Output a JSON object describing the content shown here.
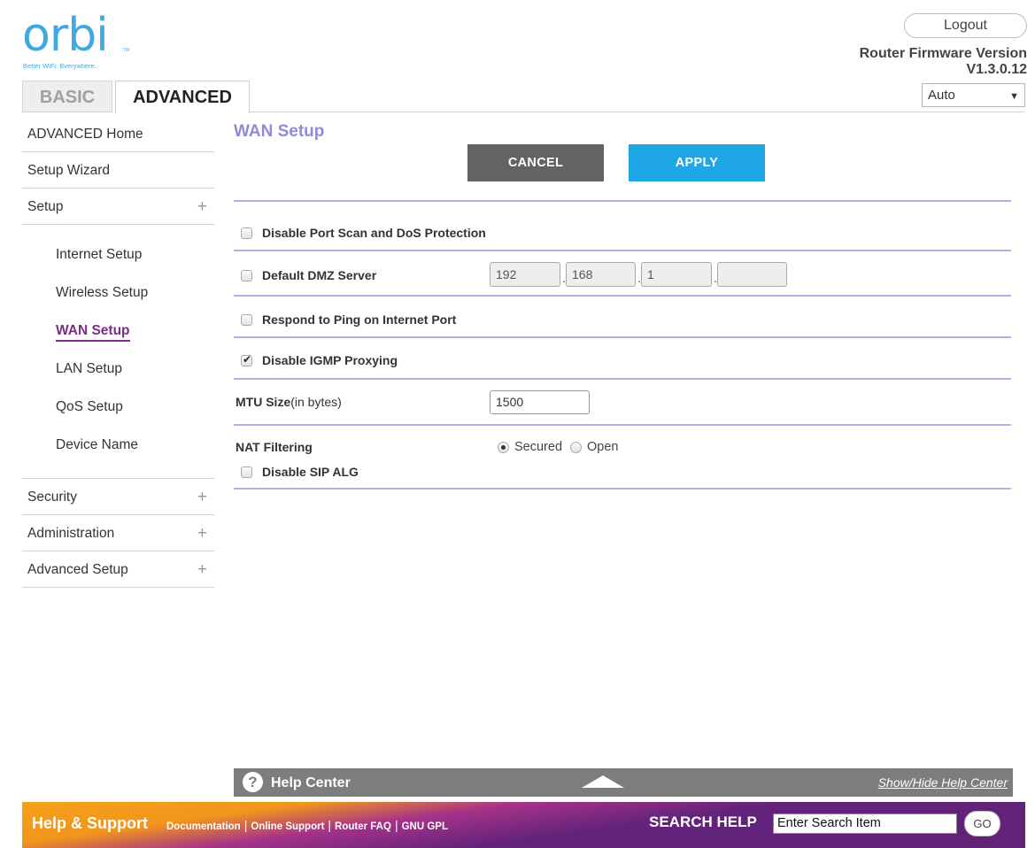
{
  "header": {
    "logo_text": "orbi",
    "logo_tm": "TM",
    "tagline": "Better WiFi. Everywhere.",
    "logout_label": "Logout",
    "firmware_label": "Router Firmware Version",
    "firmware_version": "V1.3.0.12",
    "language_value": "Auto"
  },
  "tabs": [
    {
      "label": "BASIC",
      "active": false
    },
    {
      "label": "ADVANCED",
      "active": true
    }
  ],
  "sidebar": {
    "items": [
      {
        "label": "ADVANCED Home"
      },
      {
        "label": "Setup Wizard"
      },
      {
        "label": "Setup",
        "expand": "+"
      }
    ],
    "setup_subitems": [
      {
        "label": "Internet Setup"
      },
      {
        "label": "Wireless Setup"
      },
      {
        "label": "WAN Setup",
        "active": true
      },
      {
        "label": "LAN Setup"
      },
      {
        "label": "QoS Setup"
      },
      {
        "label": "Device Name"
      }
    ],
    "bottom_items": [
      {
        "label": "Security",
        "expand": "+"
      },
      {
        "label": "Administration",
        "expand": "+"
      },
      {
        "label": "Advanced Setup",
        "expand": "+"
      }
    ]
  },
  "main": {
    "title": "WAN Setup",
    "cancel_label": "CANCEL",
    "apply_label": "APPLY",
    "disable_port_scan": {
      "label": "Disable Port Scan and DoS Protection",
      "checked": false
    },
    "default_dmz": {
      "label": "Default DMZ Server",
      "checked": false,
      "ip": [
        "192",
        "168",
        "1",
        ""
      ]
    },
    "respond_ping": {
      "label": "Respond to Ping on Internet Port",
      "checked": false
    },
    "disable_igmp": {
      "label": "Disable IGMP Proxying",
      "checked": true
    },
    "mtu": {
      "label": "MTU Size",
      "unit": "(in bytes)",
      "value": "1500"
    },
    "nat": {
      "label": "NAT Filtering",
      "options": [
        "Secured",
        "Open"
      ],
      "selected": "Secured"
    },
    "disable_sip": {
      "label": "Disable SIP ALG",
      "checked": false
    }
  },
  "help": {
    "title": "Help Center",
    "toggle": "Show/Hide Help Center"
  },
  "footer": {
    "title": "Help & Support",
    "links": [
      "Documentation",
      "Online Support",
      "Router FAQ",
      "GNU GPL"
    ],
    "search_label": "SEARCH HELP",
    "search_value": "Enter Search Item",
    "go_label": "GO"
  },
  "colors": {
    "accent_blue": "#1ea7e4",
    "title_purple": "#8f8bd8",
    "active_nav": "#7b2c86"
  }
}
